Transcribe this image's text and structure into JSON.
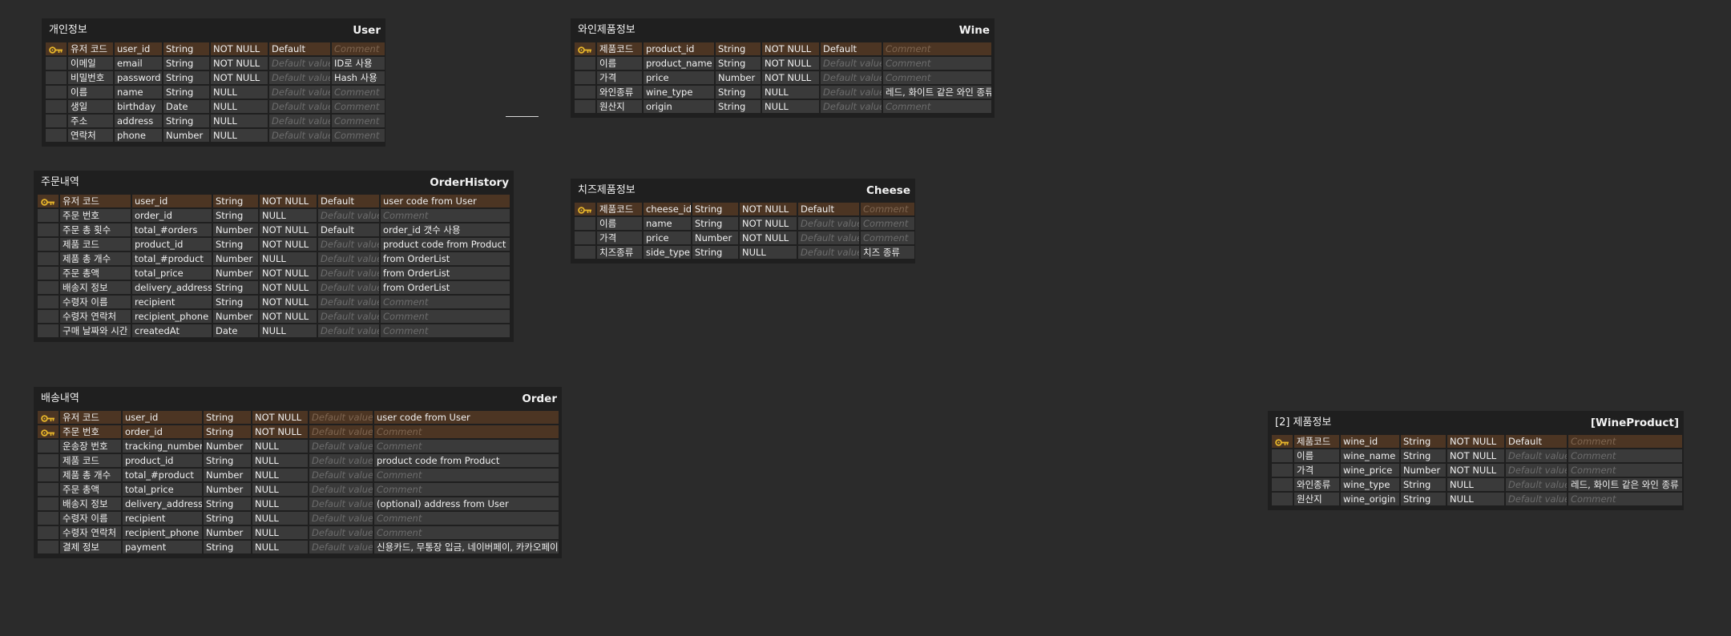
{
  "placeholders": {
    "default": "Default value",
    "comment": "Comment"
  },
  "tables": {
    "user": {
      "korean_title": "개인정보",
      "name": "User",
      "rows": [
        {
          "pk": true,
          "label": "유저 코드",
          "field": "user_id",
          "type": "String",
          "nullable": "NOT NULL",
          "default": "Default",
          "comment": ""
        },
        {
          "pk": false,
          "label": "이메일",
          "field": "email",
          "type": "String",
          "nullable": "NOT NULL",
          "default": "",
          "comment": "ID로 사용"
        },
        {
          "pk": false,
          "label": "비밀번호",
          "field": "password",
          "type": "String",
          "nullable": "NOT NULL",
          "default": "",
          "comment": "Hash 사용"
        },
        {
          "pk": false,
          "label": "이름",
          "field": "name",
          "type": "String",
          "nullable": "NULL",
          "default": "",
          "comment": ""
        },
        {
          "pk": false,
          "label": "생일",
          "field": "birthday",
          "type": "Date",
          "nullable": "NULL",
          "default": "",
          "comment": ""
        },
        {
          "pk": false,
          "label": "주소",
          "field": "address",
          "type": "String",
          "nullable": "NULL",
          "default": "",
          "comment": ""
        },
        {
          "pk": false,
          "label": "연락처",
          "field": "phone",
          "type": "Number",
          "nullable": "NULL",
          "default": "",
          "comment": ""
        }
      ]
    },
    "order_history": {
      "korean_title": "주문내역",
      "name": "OrderHistory",
      "rows": [
        {
          "pk": true,
          "label": "유저 코드",
          "field": "user_id",
          "type": "String",
          "nullable": "NOT NULL",
          "default": "Default",
          "comment": "user code from User"
        },
        {
          "pk": false,
          "label": "주문 번호",
          "field": "order_id",
          "type": "String",
          "nullable": "NULL",
          "default": "",
          "comment": ""
        },
        {
          "pk": false,
          "label": "주문 총 횟수",
          "field": "total_#orders",
          "type": "Number",
          "nullable": "NOT NULL",
          "default": "Default",
          "comment": "order_id 갯수 사용"
        },
        {
          "pk": false,
          "label": "제품 코드",
          "field": "product_id",
          "type": "String",
          "nullable": "NOT NULL",
          "default": "",
          "comment": "product code from Product"
        },
        {
          "pk": false,
          "label": "제품 총 개수",
          "field": "total_#product",
          "type": "Number",
          "nullable": "NULL",
          "default": "",
          "comment": "from OrderList"
        },
        {
          "pk": false,
          "label": "주문 총액",
          "field": "total_price",
          "type": "Number",
          "nullable": "NOT NULL",
          "default": "",
          "comment": "from OrderList"
        },
        {
          "pk": false,
          "label": "배송지 정보",
          "field": "delivery_address",
          "type": "String",
          "nullable": "NOT NULL",
          "default": "",
          "comment": "from OrderList"
        },
        {
          "pk": false,
          "label": "수령자 이름",
          "field": "recipient",
          "type": "String",
          "nullable": "NOT NULL",
          "default": "",
          "comment": ""
        },
        {
          "pk": false,
          "label": "수령자 연락처",
          "field": "recipient_phone",
          "type": "Number",
          "nullable": "NOT NULL",
          "default": "",
          "comment": ""
        },
        {
          "pk": false,
          "label": "구매 날짜와 시간",
          "field": "createdAt",
          "type": "Date",
          "nullable": "NULL",
          "default": "",
          "comment": ""
        }
      ]
    },
    "order": {
      "korean_title": "배송내역",
      "name": "Order",
      "rows": [
        {
          "pk": true,
          "label": "유저 코드",
          "field": "user_id",
          "type": "String",
          "nullable": "NOT NULL",
          "default": "",
          "comment": "user code from User"
        },
        {
          "pk": true,
          "label": "주문 번호",
          "field": "order_id",
          "type": "String",
          "nullable": "NOT NULL",
          "default": "",
          "comment": ""
        },
        {
          "pk": false,
          "label": "운송장 번호",
          "field": "tracking_number",
          "type": "Number",
          "nullable": "NULL",
          "default": "",
          "comment": ""
        },
        {
          "pk": false,
          "label": "제품 코드",
          "field": "product_id",
          "type": "String",
          "nullable": "NULL",
          "default": "",
          "comment": "product code from Product"
        },
        {
          "pk": false,
          "label": "제품 총 개수",
          "field": "total_#product",
          "type": "Number",
          "nullable": "NULL",
          "default": "",
          "comment": ""
        },
        {
          "pk": false,
          "label": "주문 총액",
          "field": "total_price",
          "type": "Number",
          "nullable": "NULL",
          "default": "",
          "comment": ""
        },
        {
          "pk": false,
          "label": "배송지 정보",
          "field": "delivery_address",
          "type": "String",
          "nullable": "NULL",
          "default": "",
          "comment": "(optional) address from User"
        },
        {
          "pk": false,
          "label": "수령자 이름",
          "field": "recipient",
          "type": "String",
          "nullable": "NULL",
          "default": "",
          "comment": ""
        },
        {
          "pk": false,
          "label": "수령자 연락처",
          "field": "recipient_phone",
          "type": "Number",
          "nullable": "NULL",
          "default": "",
          "comment": ""
        },
        {
          "pk": false,
          "label": "결제 정보",
          "field": "payment",
          "type": "String",
          "nullable": "NULL",
          "default": "",
          "comment": "신용카드, 무통장 입금, 네이버페이, 카카오페이"
        }
      ]
    },
    "wine": {
      "korean_title": "와인제품정보",
      "name": "Wine",
      "rows": [
        {
          "pk": true,
          "label": "제품코드",
          "field": "product_id",
          "type": "String",
          "nullable": "NOT NULL",
          "default": "Default",
          "comment": ""
        },
        {
          "pk": false,
          "label": "이름",
          "field": "product_name",
          "type": "String",
          "nullable": "NOT NULL",
          "default": "",
          "comment": ""
        },
        {
          "pk": false,
          "label": "가격",
          "field": "price",
          "type": "Number",
          "nullable": "NOT NULL",
          "default": "",
          "comment": ""
        },
        {
          "pk": false,
          "label": "와인종류",
          "field": "wine_type",
          "type": "String",
          "nullable": "NULL",
          "default": "",
          "comment": "레드, 화이트 같은 와인 종류"
        },
        {
          "pk": false,
          "label": "원산지",
          "field": "origin",
          "type": "String",
          "nullable": "NULL",
          "default": "",
          "comment": ""
        }
      ]
    },
    "cheese": {
      "korean_title": "치즈제품정보",
      "name": "Cheese",
      "rows": [
        {
          "pk": true,
          "label": "제품코드",
          "field": "cheese_id",
          "type": "String",
          "nullable": "NOT NULL",
          "default": "Default",
          "comment": ""
        },
        {
          "pk": false,
          "label": "이름",
          "field": "name",
          "type": "String",
          "nullable": "NOT NULL",
          "default": "",
          "comment": ""
        },
        {
          "pk": false,
          "label": "가격",
          "field": "price",
          "type": "Number",
          "nullable": "NOT NULL",
          "default": "",
          "comment": ""
        },
        {
          "pk": false,
          "label": "치즈종류",
          "field": "side_type",
          "type": "String",
          "nullable": "NULL",
          "default": "",
          "comment": "치즈 종류"
        }
      ]
    },
    "wine_product": {
      "korean_title": "[2] 제품정보",
      "name": "[WineProduct]",
      "rows": [
        {
          "pk": true,
          "label": "제품코드",
          "field": "wine_id",
          "type": "String",
          "nullable": "NOT NULL",
          "default": "Default",
          "comment": ""
        },
        {
          "pk": false,
          "label": "이름",
          "field": "wine_name",
          "type": "String",
          "nullable": "NOT NULL",
          "default": "",
          "comment": ""
        },
        {
          "pk": false,
          "label": "가격",
          "field": "wine_price",
          "type": "Number",
          "nullable": "NOT NULL",
          "default": "",
          "comment": ""
        },
        {
          "pk": false,
          "label": "와인종류",
          "field": "wine_type",
          "type": "String",
          "nullable": "NULL",
          "default": "",
          "comment": "레드, 화이트 같은 와인 종류"
        },
        {
          "pk": false,
          "label": "원산지",
          "field": "wine_origin",
          "type": "String",
          "nullable": "NULL",
          "default": "",
          "comment": ""
        }
      ]
    }
  }
}
